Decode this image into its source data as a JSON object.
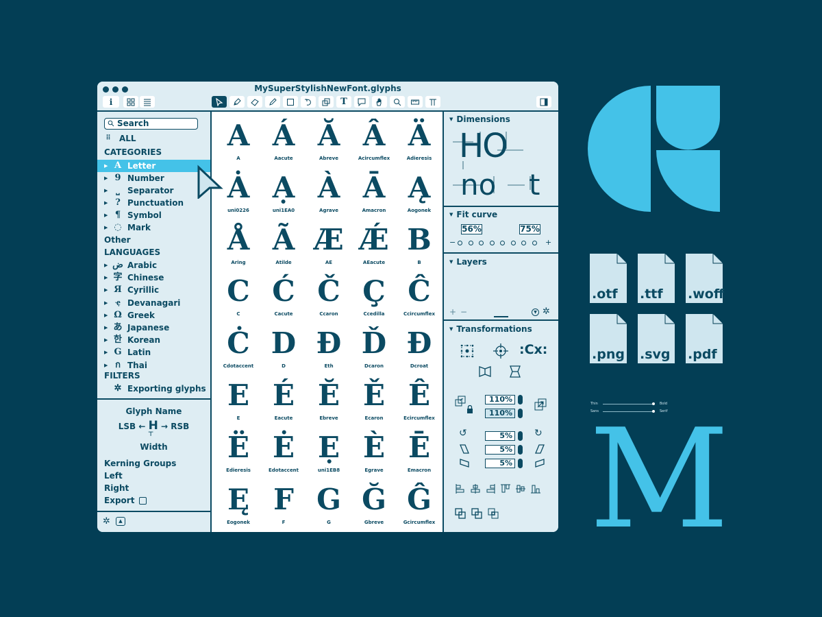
{
  "window": {
    "title": "MySuperStylishNewFont.glyphs",
    "toolbar_left": [
      {
        "name": "info-button",
        "icon": "i"
      },
      {
        "name": "grid-view-button",
        "icon": "grid"
      },
      {
        "name": "list-view-button",
        "icon": "list"
      }
    ],
    "tools": [
      {
        "name": "select-tool",
        "active": true
      },
      {
        "name": "pen-tool"
      },
      {
        "name": "eraser-tool"
      },
      {
        "name": "pencil-tool"
      },
      {
        "name": "rectangle-tool"
      },
      {
        "name": "rotate-tool"
      },
      {
        "name": "scale-tool"
      },
      {
        "name": "text-tool"
      },
      {
        "name": "annotation-tool"
      },
      {
        "name": "hand-tool"
      },
      {
        "name": "zoom-tool"
      },
      {
        "name": "measure-tool"
      },
      {
        "name": "type-tool"
      }
    ]
  },
  "sidebar": {
    "search_placeholder": "Search",
    "all_label": "ALL",
    "categories_heading": "CATEGORIES",
    "categories": [
      {
        "glyph": "A",
        "label": "Letter",
        "selected": true
      },
      {
        "glyph": "9",
        "label": "Number"
      },
      {
        "glyph": "⎵",
        "label": "Separator"
      },
      {
        "glyph": "?",
        "label": "Punctuation"
      },
      {
        "glyph": "¶",
        "label": "Symbol"
      },
      {
        "glyph": "◌",
        "label": "Mark"
      }
    ],
    "other_label": "Other",
    "languages_heading": "LANGUAGES",
    "languages": [
      {
        "glyph": "ض",
        "label": "Arabic"
      },
      {
        "glyph": "字",
        "label": "Chinese"
      },
      {
        "glyph": "Я",
        "label": "Cyrillic"
      },
      {
        "glyph": "ҿ",
        "label": "Devanagari"
      },
      {
        "glyph": "Ω",
        "label": "Greek"
      },
      {
        "glyph": "あ",
        "label": "Japanese"
      },
      {
        "glyph": "한",
        "label": "Korean"
      },
      {
        "glyph": "G",
        "label": "Latin"
      },
      {
        "glyph": "ก",
        "label": "Thai"
      }
    ],
    "filters_heading": "FILTERS",
    "filters": [
      {
        "label": "Exporting glyphs"
      }
    ],
    "glyph_info": {
      "glyph_name": "Glyph Name",
      "lsb": "LSB",
      "rsb": "RSB",
      "sample": "H",
      "width": "Width",
      "kerning_groups": "Kerning Groups",
      "left": "Left",
      "right": "Right",
      "export": "Export",
      "export_checked": false
    }
  },
  "glyphs": [
    {
      "char": "A",
      "name": "A"
    },
    {
      "char": "Á",
      "name": "Aacute"
    },
    {
      "char": "Ă",
      "name": "Abreve"
    },
    {
      "char": "Â",
      "name": "Acircumflex"
    },
    {
      "char": "Ä",
      "name": "Adieresis"
    },
    {
      "char": "Ȧ",
      "name": "uni0226"
    },
    {
      "char": "Ạ",
      "name": "uni1EA0"
    },
    {
      "char": "À",
      "name": "Agrave"
    },
    {
      "char": "Ā",
      "name": "Amacron"
    },
    {
      "char": "Ą",
      "name": "Aogonek"
    },
    {
      "char": "Å",
      "name": "Aring"
    },
    {
      "char": "Ã",
      "name": "Atilde"
    },
    {
      "char": "Æ",
      "name": "AE"
    },
    {
      "char": "Ǽ",
      "name": "AEacute"
    },
    {
      "char": "B",
      "name": "B"
    },
    {
      "char": "C",
      "name": "C"
    },
    {
      "char": "Ć",
      "name": "Cacute"
    },
    {
      "char": "Č",
      "name": "Ccaron"
    },
    {
      "char": "Ç",
      "name": "Ccedilla"
    },
    {
      "char": "Ĉ",
      "name": "Ccircumflex"
    },
    {
      "char": "Ċ",
      "name": "Cdotaccent"
    },
    {
      "char": "D",
      "name": "D"
    },
    {
      "char": "Đ",
      "name": "Eth"
    },
    {
      "char": "Ď",
      "name": "Dcaron"
    },
    {
      "char": "Đ",
      "name": "Dcroat"
    },
    {
      "char": "E",
      "name": "E"
    },
    {
      "char": "É",
      "name": "Eacute"
    },
    {
      "char": "Ĕ",
      "name": "Ebreve"
    },
    {
      "char": "Ě",
      "name": "Ecaron"
    },
    {
      "char": "Ê",
      "name": "Ecircumflex"
    },
    {
      "char": "Ë",
      "name": "Edieresis"
    },
    {
      "char": "Ė",
      "name": "Edotaccent"
    },
    {
      "char": "Ẹ",
      "name": "uni1EB8"
    },
    {
      "char": "È",
      "name": "Egrave"
    },
    {
      "char": "Ē",
      "name": "Emacron"
    },
    {
      "char": "Ę",
      "name": "Eogonek"
    },
    {
      "char": "F",
      "name": "F"
    },
    {
      "char": "G",
      "name": "G"
    },
    {
      "char": "Ğ",
      "name": "Gbreve"
    },
    {
      "char": "Ĝ",
      "name": "Gcircumflex"
    }
  ],
  "inspector": {
    "dimensions": {
      "title": "Dimensions",
      "sample_top": "HO",
      "sample_bottom_1": "no",
      "sample_bottom_2": "t"
    },
    "fit_curve": {
      "title": "Fit curve",
      "left_value": "56%",
      "right_value": "75%",
      "minus": "−",
      "plus": "+",
      "steps": 8
    },
    "layers": {
      "title": "Layers",
      "add": "+",
      "remove": "−"
    },
    "transformations": {
      "title": "Transformations",
      "scale_x": "110%",
      "scale_y": "110%",
      "rotate": "5%",
      "slant_h": "5%",
      "slant_v": "5%"
    }
  },
  "export_formats": [
    ".otf",
    ".ttf",
    ".woff",
    ".png",
    ".svg",
    ".pdf"
  ],
  "sliders": [
    {
      "left": "Thin",
      "right": "Bold",
      "value": 1.0
    },
    {
      "left": "Sans",
      "right": "Serif",
      "value": 1.0
    }
  ],
  "showcase_letter": "M",
  "colors": {
    "background": "#033e55",
    "accent": "#44c2e8",
    "panel": "#deedf3",
    "ink": "#0b4a62"
  }
}
